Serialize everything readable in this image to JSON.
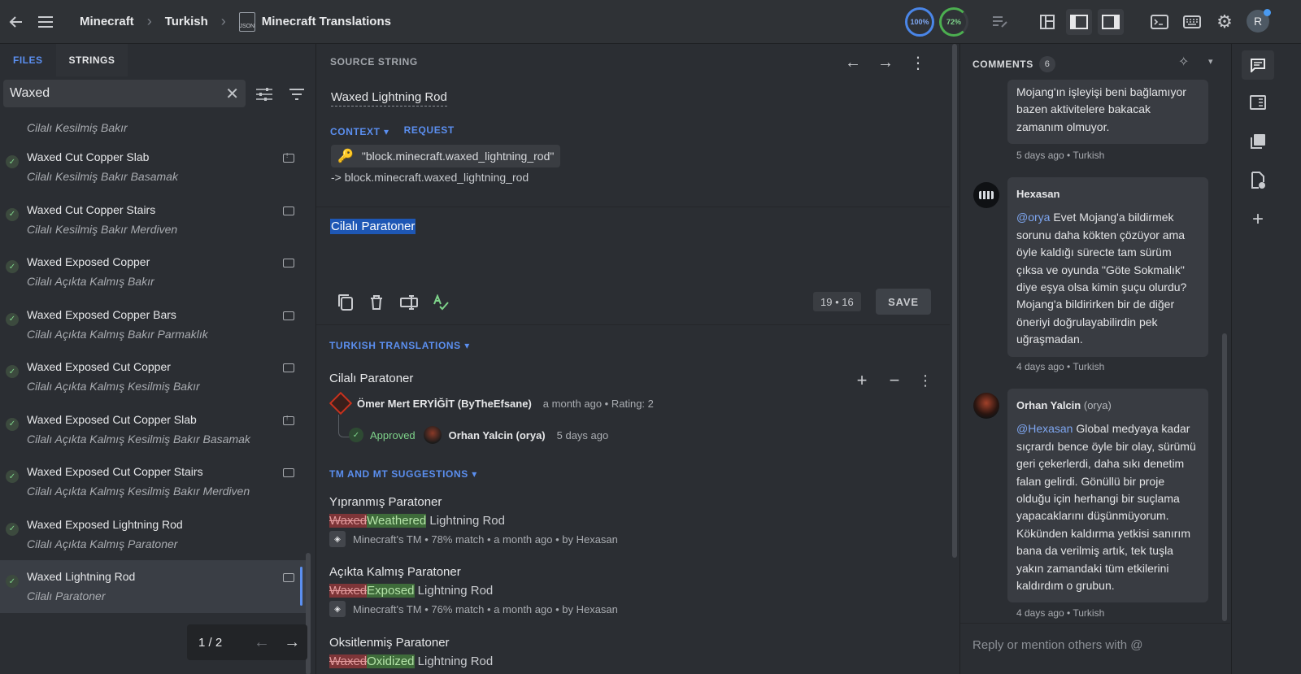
{
  "topbar": {
    "breadcrumb": [
      "Minecraft",
      "Turkish",
      "Minecraft Translations"
    ],
    "file_icon_label": "JSON",
    "progress_translated": "100%",
    "progress_approved": "72%",
    "user_initial": "R"
  },
  "left": {
    "tabs": [
      "FILES",
      "STRINGS"
    ],
    "search_value": "Waxed",
    "items": [
      {
        "source": "",
        "translation": "Cilalı Kesilmiş Bakır",
        "comment": false
      },
      {
        "source": "Waxed Cut Copper Slab",
        "translation": "Cilalı Kesilmiş Bakır Basamak",
        "comment": true
      },
      {
        "source": "Waxed Cut Copper Stairs",
        "translation": "Cilalı Kesilmiş Bakır Merdiven",
        "comment": true
      },
      {
        "source": "Waxed Exposed Copper",
        "translation": "Cilalı Açıkta Kalmış Bakır",
        "comment": true
      },
      {
        "source": "Waxed Exposed Copper Bars",
        "translation": "Cilalı Açıkta Kalmış Bakır Parmaklık",
        "comment": true
      },
      {
        "source": "Waxed Exposed Cut Copper",
        "translation": "Cilalı Açıkta Kalmış Kesilmiş Bakır",
        "comment": true
      },
      {
        "source": "Waxed Exposed Cut Copper Slab",
        "translation": "Cilalı Açıkta Kalmış Kesilmiş Bakır Basamak",
        "comment": true
      },
      {
        "source": "Waxed Exposed Cut Copper Stairs",
        "translation": "Cilalı Açıkta Kalmış Kesilmiş Bakır Merdiven",
        "comment": true
      },
      {
        "source": "Waxed Exposed Lightning Rod",
        "translation": "Cilalı Açıkta Kalmış Paratoner",
        "comment": false
      },
      {
        "source": "Waxed Lightning Rod",
        "translation": "Cilalı Paratoner",
        "comment": true
      }
    ],
    "pager": "1 / 2"
  },
  "source": {
    "header": "SOURCE STRING",
    "text": "Waxed Lightning Rod",
    "context_label": "CONTEXT",
    "request_label": "REQUEST",
    "key": "\"block.minecraft.waxed_lightning_rod\"",
    "key_path": "-> block.minecraft.waxed_lightning_rod"
  },
  "editor": {
    "text": "Cilalı Paratoner",
    "counter": "19 • 16",
    "save_label": "SAVE"
  },
  "translations": {
    "header": "TURKISH TRANSLATIONS",
    "text": "Cilalı Paratoner",
    "author": "Ömer Mert ERYİĞİT (ByTheEfsane)",
    "author_meta": "a month ago • Rating: 2",
    "approved_label": "Approved",
    "approver": "Orhan Yalcin (orya)",
    "approved_time": "5 days ago"
  },
  "tm": {
    "header": "TM AND MT SUGGESTIONS",
    "suggestions": [
      {
        "title": "Yıpranmış Paratoner",
        "del": "Waxed",
        "ins": "Weathered",
        "rest": " Lightning Rod",
        "source": "Minecraft's TM",
        "meta": "• 78% match • a month ago • by Hexasan"
      },
      {
        "title": "Açıkta Kalmış Paratoner",
        "del": "Waxed",
        "ins": "Exposed",
        "rest": " Lightning Rod",
        "source": "Minecraft's TM",
        "meta": "• 76% match • a month ago • by Hexasan"
      },
      {
        "title": "Oksitlenmiş Paratoner",
        "del": "Waxed",
        "ins": "Oxidized",
        "rest": " Lightning Rod",
        "source": "",
        "meta": ""
      }
    ]
  },
  "comments": {
    "header": "COMMENTS",
    "count": "6",
    "items": [
      {
        "author": "",
        "handle": "",
        "mention": "",
        "text": "Mojang'ın işleyişi beni bağlamıyor bazen aktivitelere bakacak zamanım olmuyor.",
        "meta": "5 days ago • Turkish"
      },
      {
        "author": "Hexasan",
        "handle": "",
        "mention": "@orya",
        "text": " Evet Mojang'a bildirmek sorunu daha kökten çözüyor ama öyle kaldığı sürecte tam sürüm çıksa ve oyunda \"Göte Sokmalık\" diye eşya olsa kimin şuçu olurdu? Mojang'a bildirirken bir de diğer öneriyi doğrulayabilirdin pek uğraşmadan.",
        "meta": "4 days ago • Turkish"
      },
      {
        "author": "Orhan Yalcin",
        "handle": "(orya)",
        "mention": "@Hexasan",
        "text": " Global medyaya kadar sıçrardı bence öyle bir olay, sürümü geri çekerlerdi, daha sıkı denetim falan gelirdi. Gönüllü bir proje olduğu için herhangi bir suçlama yapacaklarını düşünmüyorum. Kökünden kaldırma yetkisi sanırım bana da verilmiş artık, tek tuşla yakın zamandaki tüm etkilerini kaldırdım o grubun.",
        "meta": "4 days ago • Turkish"
      }
    ],
    "reply_placeholder": "Reply or mention others with @"
  },
  "colors": {
    "accent": "#5b8ff0",
    "approved": "#7ed38a",
    "highlight": "#1e57b5"
  }
}
